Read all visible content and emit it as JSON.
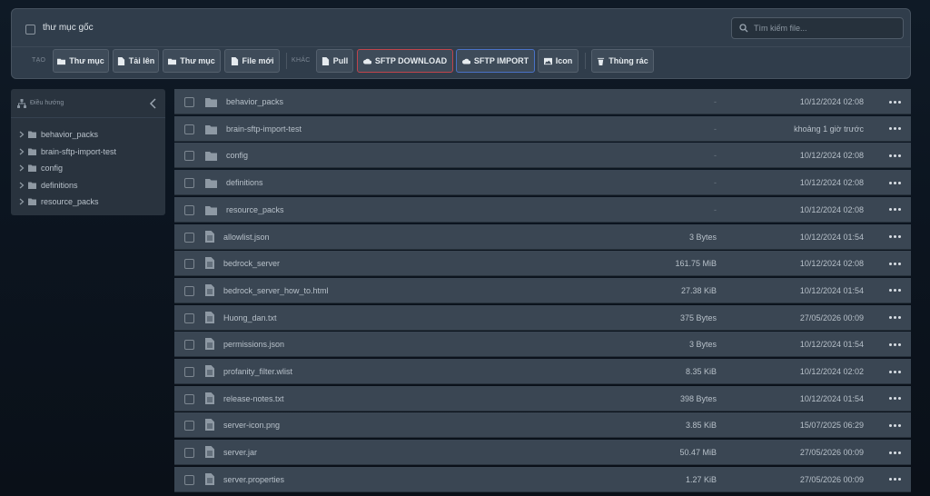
{
  "toolbar": {
    "root_label": "thư mục gốc",
    "search_placeholder": "Tìm kiếm file...",
    "group_create": "TẠO",
    "group_other": "KHÁC",
    "buttons": {
      "new_folder": "Thư mục",
      "upload": "Tải lên",
      "upload_folder": "Thư mục",
      "new_file": "File mới",
      "pull": "Pull",
      "sftp_download": "SFTP DOWNLOAD",
      "sftp_import": "SFTP IMPORT",
      "icon": "Icon",
      "trash": "Thùng rác"
    },
    "colors": {
      "download_border": "#c0444c",
      "import_border": "#4a72c7"
    }
  },
  "sidebar": {
    "title": "Điều hướng",
    "items": [
      {
        "label": "behavior_packs"
      },
      {
        "label": "brain-sftp-import-test"
      },
      {
        "label": "config"
      },
      {
        "label": "definitions"
      },
      {
        "label": "resource_packs"
      }
    ]
  },
  "files": [
    {
      "type": "folder",
      "name": "behavior_packs",
      "size": "-",
      "date": "10/12/2024 02:08"
    },
    {
      "type": "folder",
      "name": "brain-sftp-import-test",
      "size": "-",
      "date": "khoảng 1 giờ trước"
    },
    {
      "type": "folder",
      "name": "config",
      "size": "-",
      "date": "10/12/2024 02:08"
    },
    {
      "type": "folder",
      "name": "definitions",
      "size": "-",
      "date": "10/12/2024 02:08"
    },
    {
      "type": "folder",
      "name": "resource_packs",
      "size": "-",
      "date": "10/12/2024 02:08"
    },
    {
      "type": "file",
      "name": "allowlist.json",
      "size": "3 Bytes",
      "date": "10/12/2024 01:54"
    },
    {
      "type": "file",
      "name": "bedrock_server",
      "size": "161.75 MiB",
      "date": "10/12/2024 02:08"
    },
    {
      "type": "file",
      "name": "bedrock_server_how_to.html",
      "size": "27.38 KiB",
      "date": "10/12/2024 01:54"
    },
    {
      "type": "file",
      "name": "Huong_dan.txt",
      "size": "375 Bytes",
      "date": "27/05/2026 00:09"
    },
    {
      "type": "file",
      "name": "permissions.json",
      "size": "3 Bytes",
      "date": "10/12/2024 01:54"
    },
    {
      "type": "file",
      "name": "profanity_filter.wlist",
      "size": "8.35 KiB",
      "date": "10/12/2024 02:02"
    },
    {
      "type": "file",
      "name": "release-notes.txt",
      "size": "398 Bytes",
      "date": "10/12/2024 01:54"
    },
    {
      "type": "file",
      "name": "server-icon.png",
      "size": "3.85 KiB",
      "date": "15/07/2025 06:29"
    },
    {
      "type": "file",
      "name": "server.jar",
      "size": "50.47 MiB",
      "date": "27/05/2026 00:09"
    },
    {
      "type": "file",
      "name": "server.properties",
      "size": "1.27 KiB",
      "date": "27/05/2026 00:09"
    }
  ]
}
